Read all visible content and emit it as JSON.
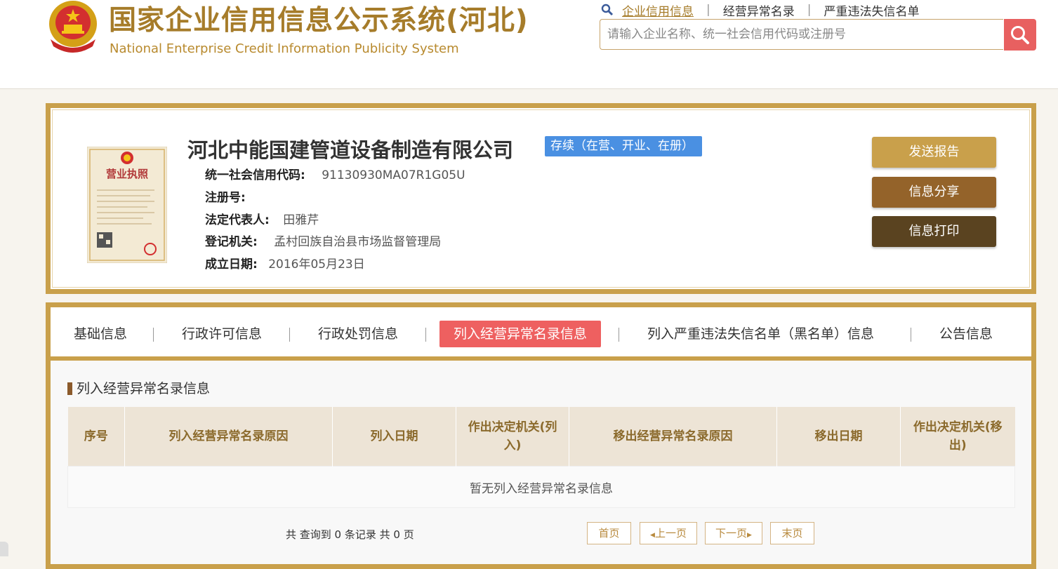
{
  "header": {
    "title_cn": "国家企业信用信息公示系统(河北)",
    "title_en": "National Enterprise Credit Information Publicity System",
    "links": [
      "企业信用信息",
      "经营异常名录",
      "严重违法失信名单"
    ],
    "search_placeholder": "请输入企业名称、统一社会信用代码或注册号"
  },
  "company": {
    "name": "河北中能国建管道设备制造有限公司",
    "status": "存续（在营、开业、在册）",
    "fields": [
      {
        "label": "统一社会信用代码:",
        "value": "91130930MA07R1G05U"
      },
      {
        "label": "注册号:",
        "value": ""
      },
      {
        "label": "法定代表人:",
        "value": "田雅芹"
      },
      {
        "label": "登记机关:",
        "value": "孟村回族自治县市场监督管理局"
      },
      {
        "label": "成立日期:",
        "value": "2016年05月23日"
      }
    ],
    "license_title": "营业执照"
  },
  "actions": {
    "send_report": "发送报告",
    "share": "信息分享",
    "print": "信息打印"
  },
  "tabs": [
    "基础信息",
    "行政许可信息",
    "行政处罚信息",
    "列入经营异常名录信息",
    "列入严重违法失信名单（黑名单）信息",
    "公告信息"
  ],
  "section": {
    "title": "列入经营异常名录信息",
    "columns": [
      "序号",
      "列入经营异常名录原因",
      "列入日期",
      "作出决定机关(列入)",
      "移出经营异常名录原因",
      "移出日期",
      "作出决定机关(移出)"
    ],
    "empty_text": "暂无列入经营异常名录信息"
  },
  "pagination": {
    "summary": "共 查询到 0 条记录 共 0 页",
    "first": "首页",
    "prev": "上一页",
    "next": "下一页",
    "last": "末页"
  },
  "colors": {
    "accent_gold": "#c9a04b",
    "status_blue": "#4a90e2",
    "active_tab_red": "#ee6060",
    "search_red": "#e86060"
  }
}
